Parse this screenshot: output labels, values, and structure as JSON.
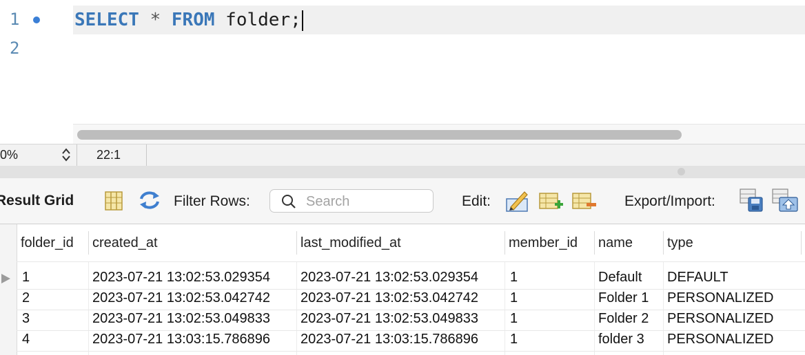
{
  "editor": {
    "line_numbers": [
      "1",
      "2"
    ],
    "code": {
      "kw1": "SELECT",
      "star": "*",
      "kw2": "FROM",
      "table": "folder;"
    }
  },
  "statusbar": {
    "zoom": "0%",
    "cursor_position": "22:1"
  },
  "toolbar": {
    "result_title": "Result Grid",
    "filter_label": "Filter Rows:",
    "search_placeholder": "Search",
    "edit_label": "Edit:",
    "export_label": "Export/Import:"
  },
  "grid": {
    "columns": [
      "folder_id",
      "created_at",
      "last_modified_at",
      "member_id",
      "name",
      "type"
    ],
    "rows": [
      [
        "1",
        "2023-07-21 13:02:53.029354",
        "2023-07-21 13:02:53.029354",
        "1",
        "Default",
        "DEFAULT"
      ],
      [
        "2",
        "2023-07-21 13:02:53.042742",
        "2023-07-21 13:02:53.042742",
        "1",
        "Folder 1",
        "PERSONALIZED"
      ],
      [
        "3",
        "2023-07-21 13:02:53.049833",
        "2023-07-21 13:02:53.049833",
        "1",
        "Folder 2",
        "PERSONALIZED"
      ],
      [
        "4",
        "2023-07-21 13:03:15.786896",
        "2023-07-21 13:03:15.786896",
        "1",
        "folder 3",
        "PERSONALIZED"
      ]
    ]
  },
  "colors": {
    "keyword": "#3a77b8",
    "line_number": "#5a8ab3",
    "breakpoint_dot": "#3b7fd6",
    "toolbar_bg": "#f6f6f6"
  },
  "icons": [
    "breakpoint-dot-icon",
    "grid-view-icon",
    "refresh-icon",
    "search-icon",
    "edit-pencil-icon",
    "add-row-icon",
    "delete-row-icon",
    "export-save-icon",
    "import-icon",
    "row-pointer-icon",
    "stepper-icon"
  ]
}
